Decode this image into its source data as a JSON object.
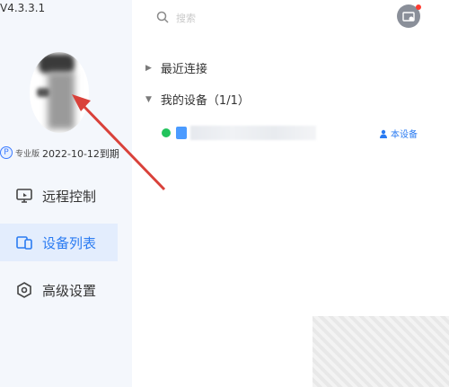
{
  "app": {
    "version": "V4.3.3.1"
  },
  "profile": {
    "pro_badge": "P",
    "pro_label": "专业版",
    "expiry": "2022-10-12到期"
  },
  "nav": {
    "items": [
      {
        "label": "远程控制",
        "icon": "monitor-icon",
        "active": false
      },
      {
        "label": "设备列表",
        "icon": "device-list-icon",
        "active": true
      },
      {
        "label": "高级设置",
        "icon": "settings-icon",
        "active": false
      }
    ]
  },
  "search": {
    "placeholder": "搜索"
  },
  "sections": {
    "recent": {
      "label": "最近连接",
      "expanded": false
    },
    "my_devices": {
      "label": "我的设备（1/1）",
      "expanded": true
    }
  },
  "devices": [
    {
      "status": "online",
      "status_color": "#22c35c",
      "tag": "本设备"
    }
  ],
  "colors": {
    "accent": "#2a7bf2",
    "sidebar_bg": "#f4f7fc",
    "active_bg": "#e3edfd",
    "annotation_arrow": "#d9413a"
  }
}
